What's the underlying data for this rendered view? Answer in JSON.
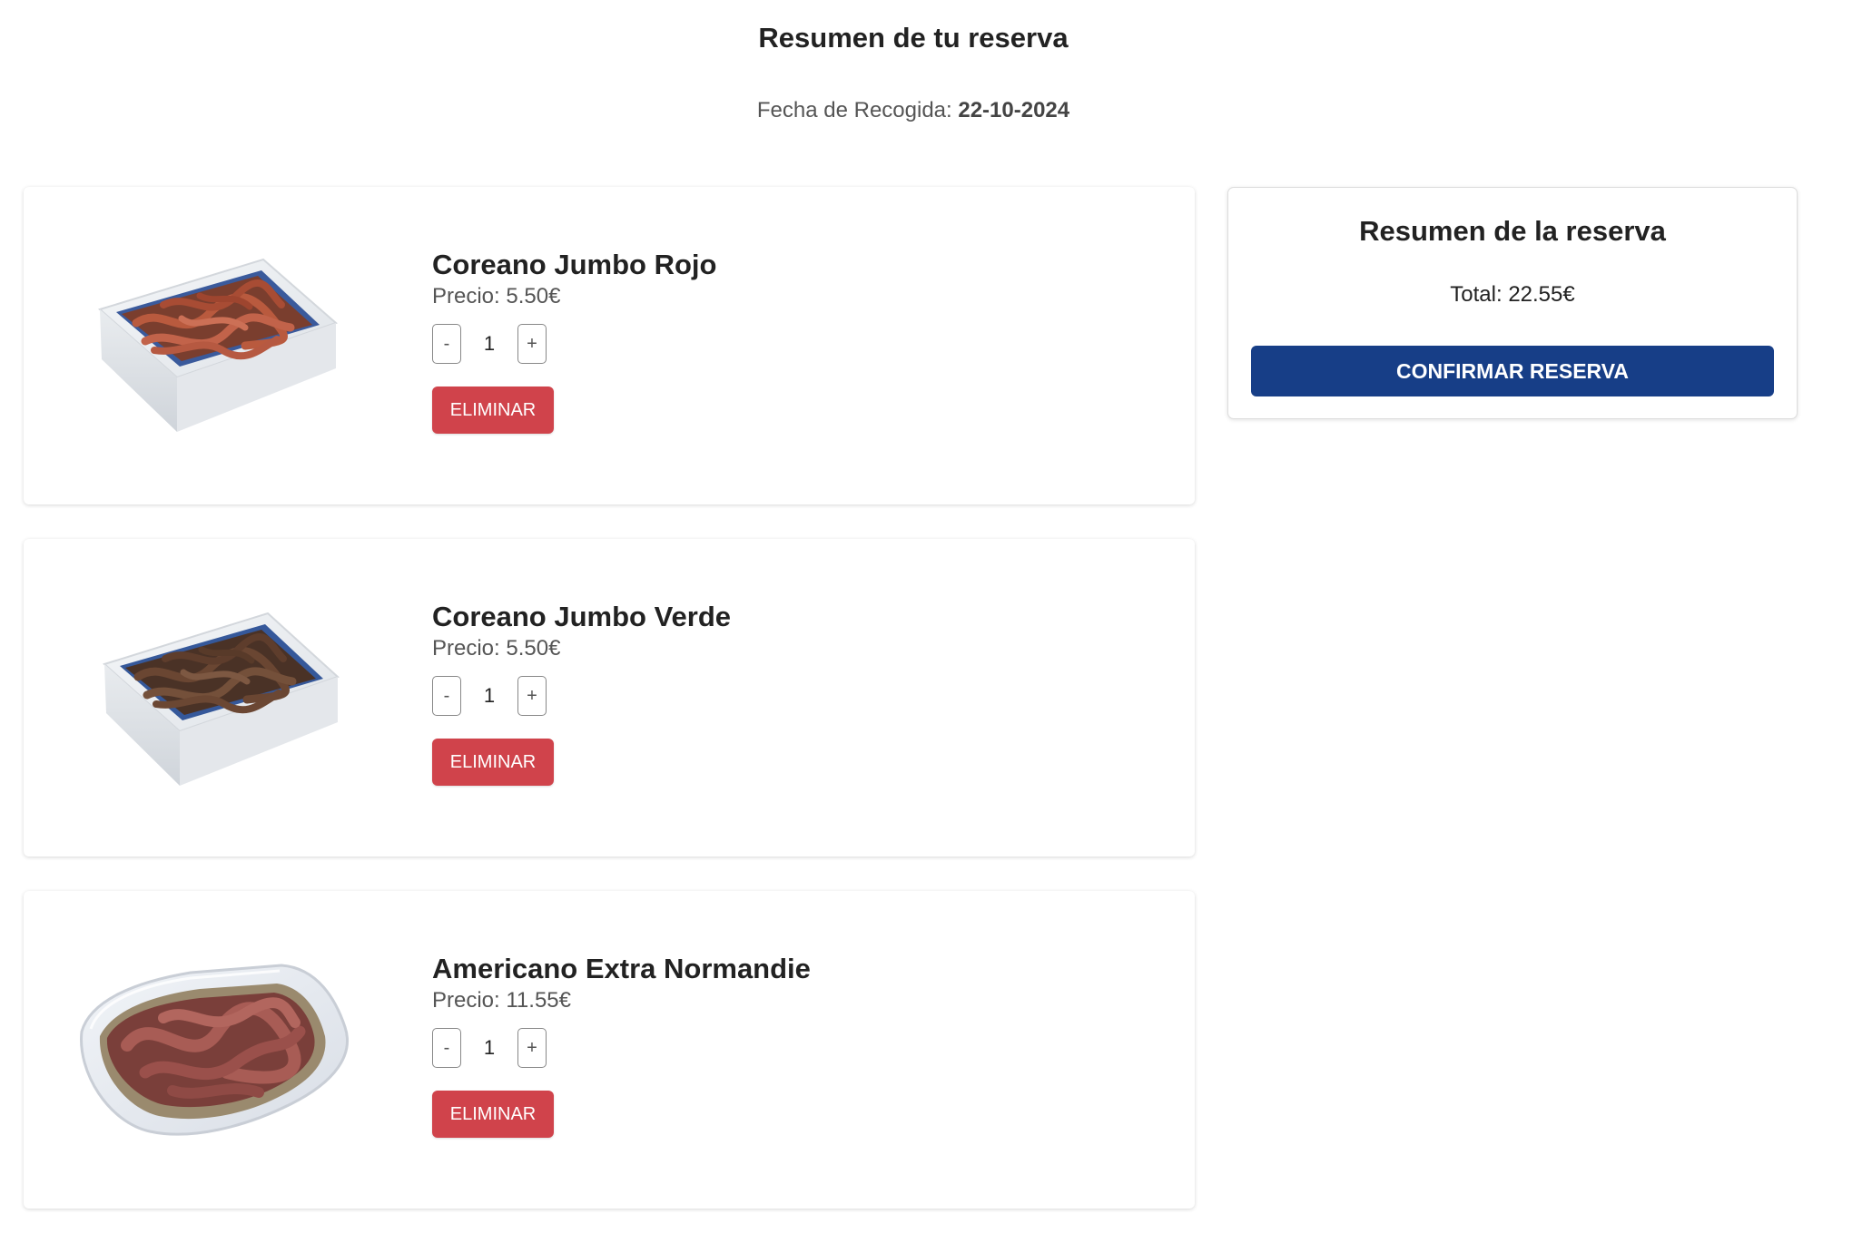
{
  "header": {
    "title": "Resumen de tu reserva",
    "pickup_label": "Fecha de Recogida:",
    "pickup_date": "22-10-2024"
  },
  "items": [
    {
      "name": "Coreano Jumbo Rojo",
      "price": "Precio: 5.50€",
      "quantity": "1",
      "minus": "-",
      "plus": "+",
      "delete_label": "ELIMINAR",
      "image": "red-worms-in-foam-tray"
    },
    {
      "name": "Coreano Jumbo Verde",
      "price": "Precio: 5.50€",
      "quantity": "1",
      "minus": "-",
      "plus": "+",
      "delete_label": "ELIMINAR",
      "image": "green-worms-in-foam-tray"
    },
    {
      "name": "Americano Extra Normandie",
      "price": "Precio: 11.55€",
      "quantity": "1",
      "minus": "-",
      "plus": "+",
      "delete_label": "ELIMINAR",
      "image": "worms-in-clear-plastic-container"
    }
  ],
  "summary": {
    "title": "Resumen de la reserva",
    "total": "Total: 22.55€",
    "confirm_label": "CONFIRMAR RESERVA"
  },
  "colors": {
    "confirm_button": "#173e87",
    "delete_button": "#d0434b",
    "text": "#222222",
    "muted_text": "#555555"
  }
}
